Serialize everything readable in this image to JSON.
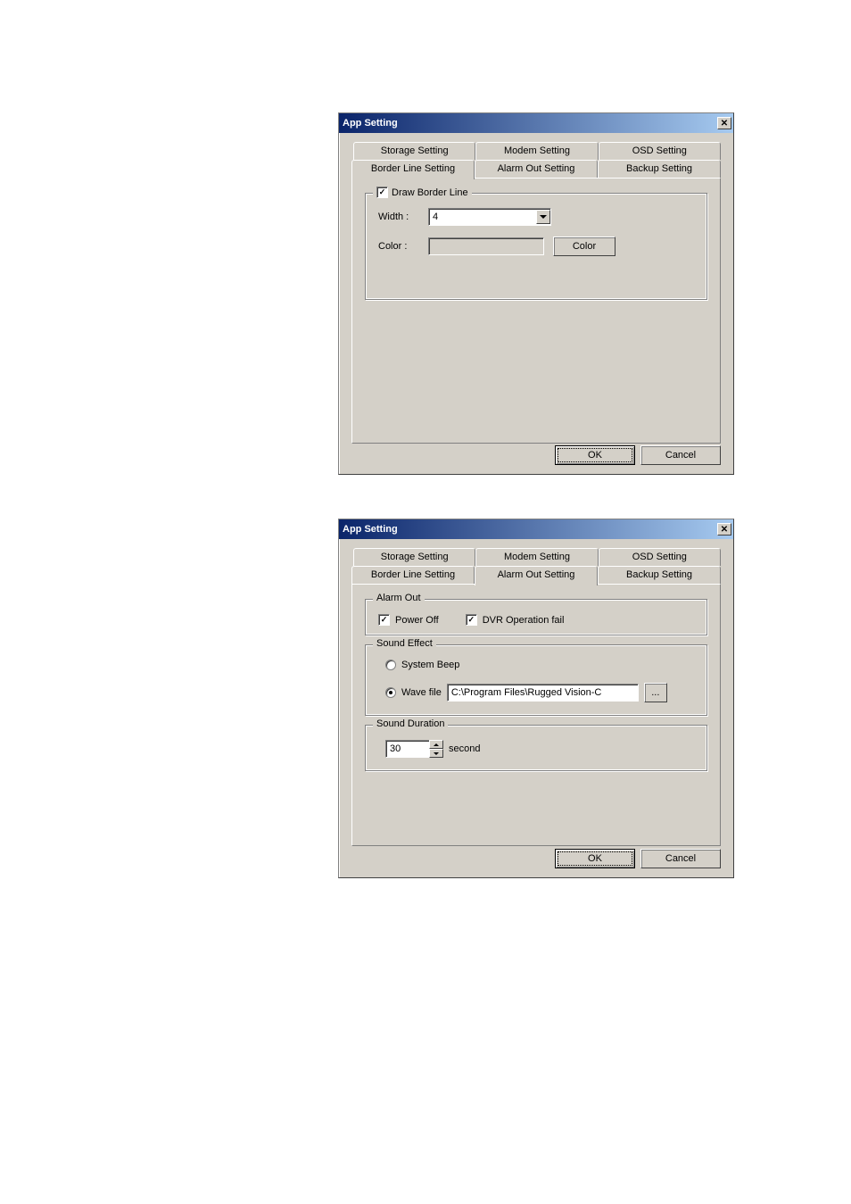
{
  "dialog1": {
    "title": "App Setting",
    "tabs": {
      "row1": [
        "Storage Setting",
        "Modem Setting",
        "OSD Setting"
      ],
      "row2": [
        "Border Line Setting",
        "Alarm Out Setting",
        "Backup Setting"
      ]
    },
    "active_tab": "Border Line Setting",
    "border_group": {
      "checkbox_label": "Draw Border Line",
      "checkbox_checked": true,
      "width_label": "Width :",
      "width_value": "4",
      "color_label": "Color :",
      "color_button": "Color"
    },
    "ok": "OK",
    "cancel": "Cancel"
  },
  "dialog2": {
    "title": "App Setting",
    "tabs": {
      "row1": [
        "Storage Setting",
        "Modem Setting",
        "OSD Setting"
      ],
      "row2": [
        "Border Line Setting",
        "Alarm Out Setting",
        "Backup Setting"
      ]
    },
    "active_tab": "Alarm Out Setting",
    "alarm_out": {
      "legend": "Alarm Out",
      "power_off_label": "Power Off",
      "power_off_checked": true,
      "dvr_fail_label": "DVR Operation fail",
      "dvr_fail_checked": true
    },
    "sound_effect": {
      "legend": "Sound Effect",
      "system_beep_label": "System Beep",
      "system_beep_selected": false,
      "wave_file_label": "Wave file",
      "wave_file_selected": true,
      "wave_file_path": "C:\\Program Files\\Rugged Vision-C",
      "browse_button": "..."
    },
    "sound_duration": {
      "legend": "Sound Duration",
      "value": "30",
      "unit": "second"
    },
    "ok": "OK",
    "cancel": "Cancel"
  }
}
